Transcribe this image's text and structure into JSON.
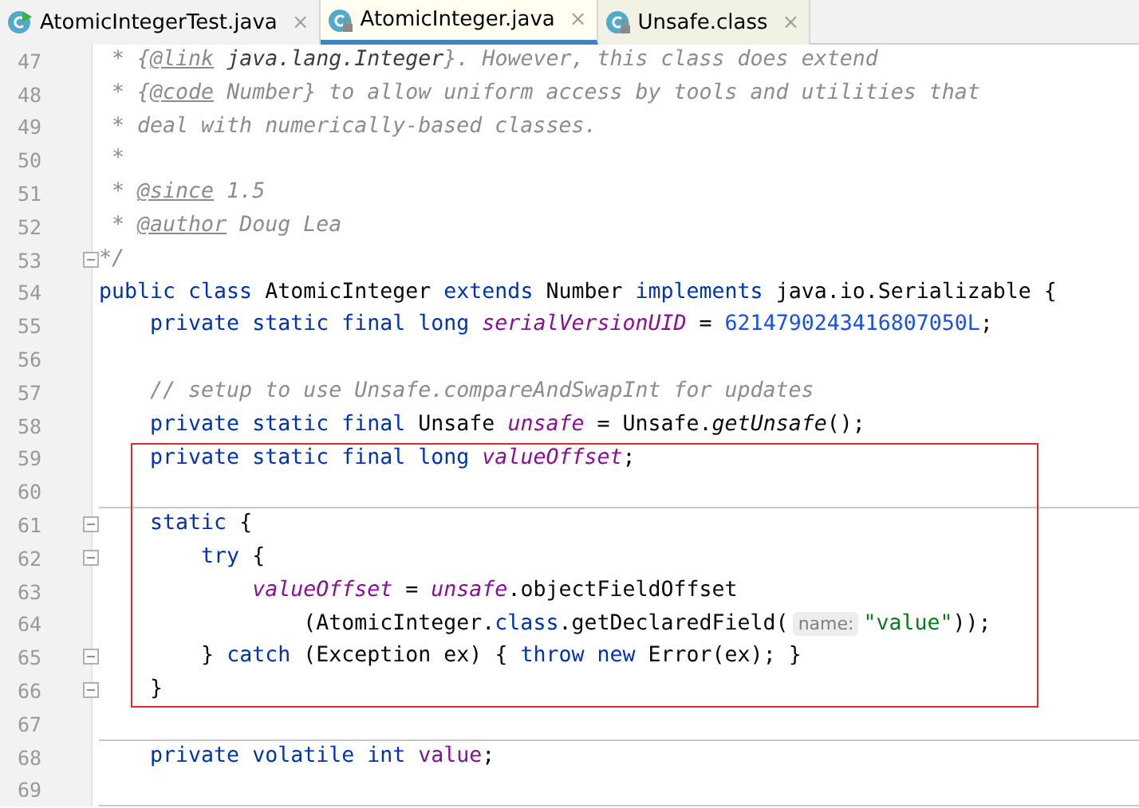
{
  "tabs": [
    {
      "label": "AtomicIntegerTest.java",
      "close": "×",
      "selected": false,
      "kind": "runnable"
    },
    {
      "label": "AtomicInteger.java",
      "close": "×",
      "selected": true,
      "kind": "locked"
    },
    {
      "label": "Unsafe.class",
      "close": "×",
      "selected": false,
      "kind": "compiled"
    }
  ],
  "editor": {
    "blocks": [
      {
        "highlighted": false,
        "lines": [
          {
            "number": "47",
            "tokens": [
              {
                "kind": "comment",
                "text": " * {"
              },
              {
                "kind": "doctag",
                "text": "@link"
              },
              {
                "kind": "docref",
                "text": " java.lang.Integer"
              },
              {
                "kind": "comment",
                "text": "}. However, this class does extend"
              }
            ]
          },
          {
            "number": "48",
            "tokens": [
              {
                "kind": "comment",
                "text": " * {"
              },
              {
                "kind": "doctag",
                "text": "@code"
              },
              {
                "kind": "comment",
                "text": " Number} to allow uniform access by tools and utilities that"
              }
            ]
          },
          {
            "number": "49",
            "tokens": [
              {
                "kind": "comment",
                "text": " * deal with numerically-based classes."
              }
            ]
          },
          {
            "number": "50",
            "tokens": [
              {
                "kind": "comment",
                "text": " *"
              }
            ]
          },
          {
            "number": "51",
            "tokens": [
              {
                "kind": "comment",
                "text": " * "
              },
              {
                "kind": "doctag",
                "text": "@since"
              },
              {
                "kind": "comment",
                "text": " 1.5"
              }
            ]
          },
          {
            "number": "52",
            "tokens": [
              {
                "kind": "comment",
                "text": " * "
              },
              {
                "kind": "doctag",
                "text": "@author"
              },
              {
                "kind": "comment",
                "text": " Doug Lea"
              }
            ]
          },
          {
            "number": "53",
            "fold": true,
            "tokens": [
              {
                "kind": "comment",
                "text": "*/"
              }
            ]
          },
          {
            "number": "54",
            "tokens": [
              {
                "kind": "keyword",
                "text": "public class "
              },
              {
                "kind": "plain",
                "text": "AtomicInteger "
              },
              {
                "kind": "keyword",
                "text": "extends "
              },
              {
                "kind": "plain",
                "text": "Number "
              },
              {
                "kind": "keyword",
                "text": "implements "
              },
              {
                "kind": "plain",
                "text": "java.io.Serializable {"
              }
            ]
          },
          {
            "number": "55",
            "tokens": [
              {
                "kind": "keyword",
                "text": "    private static final long "
              },
              {
                "kind": "field",
                "text": "serialVersionUID"
              },
              {
                "kind": "plain",
                "text": " = "
              },
              {
                "kind": "number",
                "text": "6214790243416807050L"
              },
              {
                "kind": "plain",
                "text": ";"
              }
            ]
          },
          {
            "number": "56"
          },
          {
            "number": "57",
            "tokens": [
              {
                "kind": "comment",
                "text": "    // setup to use Unsafe.compareAndSwapInt for updates"
              }
            ]
          },
          {
            "number": "58",
            "tokens": [
              {
                "kind": "keyword",
                "text": "    private static final "
              },
              {
                "kind": "plain",
                "text": "Unsafe "
              },
              {
                "kind": "field",
                "text": "unsafe"
              },
              {
                "kind": "plain",
                "text": " = Unsafe."
              },
              {
                "kind": "method",
                "text": "getUnsafe"
              },
              {
                "kind": "plain",
                "text": "();"
              }
            ]
          }
        ]
      },
      {
        "highlighted": true,
        "lines": [
          {
            "number": "59",
            "tokens": [
              {
                "kind": "keyword",
                "text": "    private static final long "
              },
              {
                "kind": "field",
                "text": "valueOffset"
              },
              {
                "kind": "plain",
                "text": ";"
              }
            ]
          },
          {
            "number": "60",
            "separator_below": true
          },
          {
            "number": "61",
            "fold": true,
            "tokens": [
              {
                "kind": "keyword",
                "text": "    static "
              },
              {
                "kind": "plain",
                "text": "{"
              }
            ]
          },
          {
            "number": "62",
            "fold": true,
            "tokens": [
              {
                "kind": "keyword",
                "text": "        try "
              },
              {
                "kind": "plain",
                "text": "{"
              }
            ]
          },
          {
            "number": "63",
            "tokens": [
              {
                "kind": "field",
                "text": "            valueOffset"
              },
              {
                "kind": "plain",
                "text": " = "
              },
              {
                "kind": "field",
                "text": "unsafe"
              },
              {
                "kind": "plain",
                "text": ".objectFieldOffset"
              }
            ]
          },
          {
            "number": "64",
            "tokens": [
              {
                "kind": "plain",
                "text": "                (AtomicInteger."
              },
              {
                "kind": "keyword",
                "text": "class"
              },
              {
                "kind": "plain",
                "text": ".getDeclaredField("
              },
              {
                "kind": "hint",
                "text": "name:"
              },
              {
                "kind": "string",
                "text": "\"value\""
              },
              {
                "kind": "plain",
                "text": "));"
              }
            ]
          },
          {
            "number": "65",
            "fold": true,
            "tokens": [
              {
                "kind": "plain",
                "text": "        } "
              },
              {
                "kind": "keyword",
                "text": "catch "
              },
              {
                "kind": "plain",
                "text": "(Exception ex) { "
              },
              {
                "kind": "keyword",
                "text": "throw new "
              },
              {
                "kind": "plain",
                "text": "Error(ex); }"
              }
            ]
          },
          {
            "number": "66",
            "fold": true,
            "tokens": [
              {
                "kind": "plain",
                "text": "    }"
              }
            ]
          }
        ]
      },
      {
        "highlighted": false,
        "lines": [
          {
            "number": "67",
            "separator_below": true
          },
          {
            "number": "68",
            "tokens": [
              {
                "kind": "keyword",
                "text": "    private volatile int "
              },
              {
                "kind": "field-plain",
                "text": "value"
              },
              {
                "kind": "plain",
                "text": ";"
              }
            ]
          },
          {
            "number": "69",
            "separator_below": true
          }
        ]
      }
    ]
  }
}
